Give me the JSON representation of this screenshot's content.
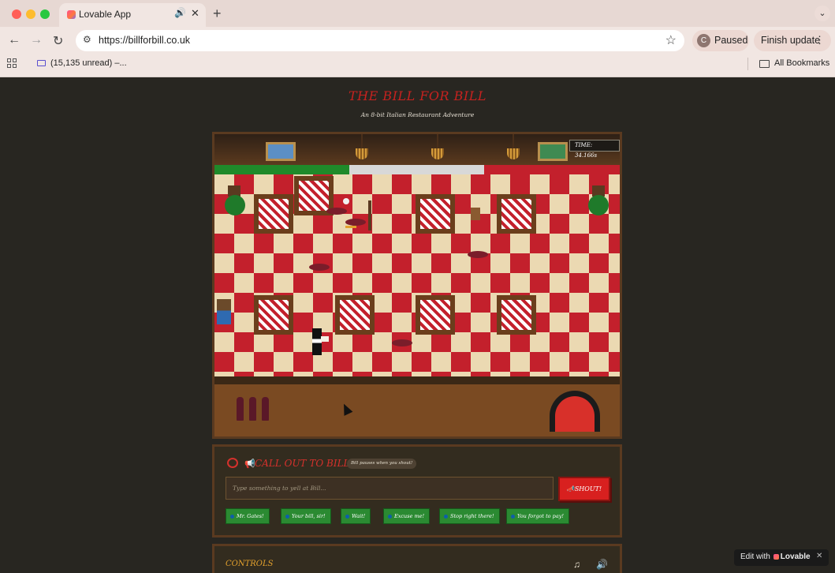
{
  "browser": {
    "tab_title": "Lovable App",
    "tab_audio_icon": "speaker-icon",
    "url": "https://billforbill.co.uk",
    "profile_initial": "C",
    "profile_label": "Paused",
    "update_label": "Finish update",
    "bookmark_mail": "(15,135 unread) –...",
    "bookmark_all": "All Bookmarks",
    "glyphs": {
      "close": "✕",
      "new_tab": "+",
      "tabs_menu": "⌄",
      "back": "←",
      "forward": "→",
      "reload": "↻",
      "site_info": "⚙",
      "star": "☆",
      "kebab": "⋮",
      "audio": "🔊"
    }
  },
  "game": {
    "title": "THE BILL FOR BILL",
    "subtitle": "An 8-bit Italian Restaurant Adventure",
    "timer": "TIME: 34.166s",
    "colors": {
      "floor_red": "#c3202c",
      "floor_cream": "#ebd9b2",
      "flag_green": "#1f8a2a",
      "flag_white": "#d8d8d8",
      "flag_red": "#c3202c"
    }
  },
  "callout": {
    "title": "CALL OUT TO BILL!",
    "mega_glyph": "📢",
    "pause_note": "Bill pauses when you shout!",
    "input_placeholder": "Type something to yell at Bill...",
    "shout_label": "📣SHOUT!",
    "quick_phrases": [
      "Mr. Gates!",
      "Your bill, sir!",
      "Wait!",
      "Excuse me!",
      "Stop right there!",
      "You forgot to pay!"
    ]
  },
  "controls": {
    "title": "CONTROLS",
    "music_glyph": "♫",
    "sound_glyph": "🔊"
  },
  "lovable": {
    "prefix": "Edit with",
    "brand": "Lovable",
    "close": "✕"
  }
}
